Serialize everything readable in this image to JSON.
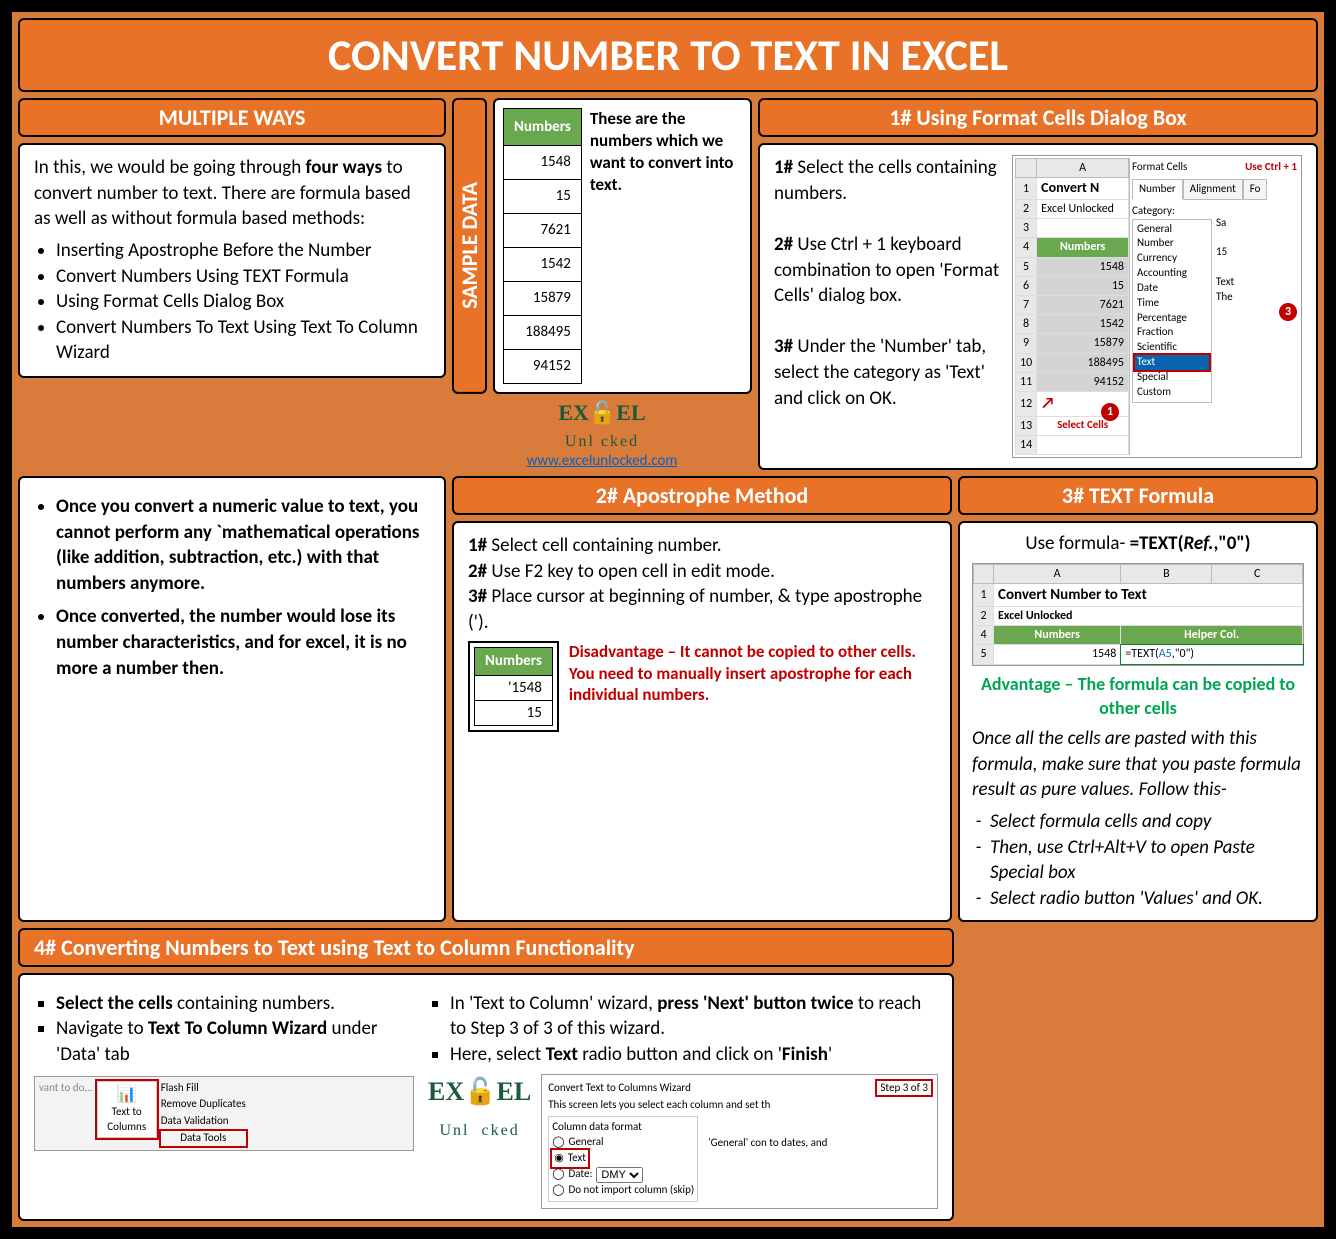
{
  "title": "CONVERT NUMBER TO TEXT IN EXCEL",
  "multiple": {
    "header": "MULTIPLE WAYS",
    "intro_a": "In this, we would be going through ",
    "intro_b": "four ways",
    "intro_c": " to convert number to text. There are formula based as well as without formula based methods:",
    "items": [
      "Inserting Apostrophe Before the Number",
      "Convert Numbers Using TEXT Formula",
      "Using Format Cells Dialog Box",
      "Convert Numbers To Text Using Text To Column Wizard"
    ]
  },
  "sample": {
    "label": "SAMPLE DATA",
    "col_header": "Numbers",
    "values": [
      "1548",
      "15",
      "7621",
      "1542",
      "15879",
      "188495",
      "94152"
    ],
    "caption": "These are the numbers which we want to convert into text."
  },
  "logo": {
    "brand_a": "EX",
    "brand_b": "C",
    "brand_c": "EL",
    "sub": "Unl   cked",
    "url": "www.excelunlocked.com"
  },
  "m1": {
    "header": "1# Using Format Cells Dialog Box",
    "s1a": "1#",
    "s1b": " Select the cells containing numbers.",
    "s2a": "2#",
    "s2b": " Use Ctrl + 1 keyboard combination to open 'Format Cells' dialog box.",
    "s3a": "3#",
    "s3b": " Under the 'Number' tab, select the category as 'Text' and click on OK.",
    "mock": {
      "title_cell": "Convert N",
      "sub_cell": "Excel Unlocked",
      "col": "Numbers",
      "vals": [
        "1548",
        "15",
        "7621",
        "1542",
        "15879",
        "188495",
        "94152"
      ],
      "fc_title": "Format Cells",
      "hint": "Use Ctrl + 1",
      "tabs": [
        "Number",
        "Alignment",
        "Fo"
      ],
      "cat_label": "Category:",
      "cats": [
        "General",
        "Number",
        "Currency",
        "Accounting",
        "Date",
        "Time",
        "Percentage",
        "Fraction",
        "Scientific",
        "Text",
        "Special",
        "Custom"
      ],
      "sample_label": "Sa",
      "sample_vals": [
        "15",
        "Text",
        "The"
      ],
      "badge1": "1",
      "badge3": "3",
      "sel_label": "Select Cells"
    }
  },
  "notes": {
    "n1": "Once you convert a numeric value to text, you cannot perform any `mathematical operations (like addition, subtraction, etc.) with that numbers anymore.",
    "n2": "Once converted, the number would lose its number characteristics, and for excel, it is no more a number then."
  },
  "m2": {
    "header": "2# Apostrophe Method",
    "s1a": "1#",
    "s1b": " Select cell containing number.",
    "s2a": "2#",
    "s2b": " Use F2 key to open cell in edit mode.",
    "s3a": "3#",
    "s3b": " Place cursor at beginning of number, & type apostrophe (').",
    "mock": {
      "col": "Numbers",
      "v1": "'1548",
      "v2": "15"
    },
    "disadv": "Disadvantage – It cannot be copied to other cells. You need to manually insert apostrophe for each individual numbers."
  },
  "m3": {
    "header": "3# TEXT Formula",
    "use_a": "Use formula-  ",
    "use_b": "=TEXT(",
    "use_c": "Ref.",
    "use_d": ",\"0\")",
    "mock": {
      "colA": "A",
      "colB": "B",
      "colC": "C",
      "r1": "Convert Number to Text",
      "r2": "Excel Unlocked",
      "h1": "Numbers",
      "h2": "Helper Col.",
      "v1": "1548",
      "f1a": "=TEXT(",
      "f1b": "A5",
      "f1c": ",\"0\")"
    },
    "adv": "Advantage – The formula can be copied to other cells",
    "note": "Once all the cells are pasted with this formula, make sure that you paste formula result as pure values. Follow this-",
    "steps": [
      "Select formula cells and copy",
      "Then, use Ctrl+Alt+V to open Paste Special box",
      "Select radio button 'Values' and OK."
    ]
  },
  "m4": {
    "header": "4# Converting Numbers to Text using Text to Column Functionality",
    "l1a": "Select the cells",
    "l1b": " containing numbers.",
    "l2a": "Navigate to ",
    "l2b": "Text To Column Wizard",
    "l2c": " under 'Data' tab",
    "r1a": "In 'Text to Column' wizard, ",
    "r1b": "press 'Next' button twice",
    "r1c": " to reach to Step 3 of 3 of this wizard.",
    "r2a": "Here, select ",
    "r2b": "Text",
    "r2c": " radio button and click on '",
    "r2d": "Finish",
    "r2e": "'",
    "ribbon": {
      "hint": "vant to do...",
      "btn": "Text to Columns",
      "items": [
        "Flash Fill",
        "Remove Duplicates",
        "Data Validation"
      ],
      "group": "Data Tools"
    },
    "wizard": {
      "title": "Convert Text to Columns Wizard",
      "step": "Step 3 of 3",
      "sub": "This screen lets you select each column and set th",
      "group": "Column data format",
      "opts": [
        "General",
        "Text",
        "Date:",
        "Do not import column (skip)"
      ],
      "date_fmt": "DMY",
      "note": "'General' con to dates, and"
    }
  }
}
